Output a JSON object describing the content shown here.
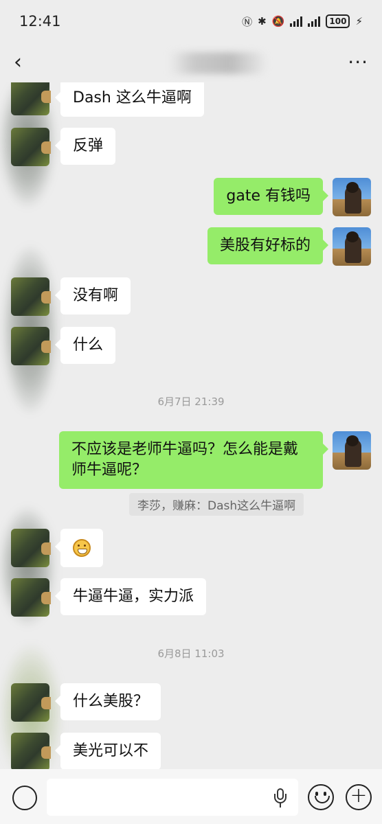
{
  "status_bar": {
    "time": "12:41",
    "battery": "100"
  },
  "nav": {
    "back_icon": "chevron-left-icon",
    "more_icon": "more-dots-icon"
  },
  "messages": [
    {
      "dir": "in",
      "text": "Dash 这么牛逼啊"
    },
    {
      "dir": "in",
      "text": "反弹"
    },
    {
      "dir": "out",
      "text": "gate 有钱吗"
    },
    {
      "dir": "out",
      "text": "美股有好标的"
    },
    {
      "dir": "in",
      "text": "没有啊"
    },
    {
      "dir": "in",
      "text": "什么"
    },
    {
      "dir": "out",
      "text": "不应该是老师牛逼吗？怎么能是戴师牛逼呢？"
    },
    {
      "dir": "in",
      "text": "",
      "emoji": "grinning-face-icon"
    },
    {
      "dir": "in",
      "text": "牛逼牛逼，实力派"
    },
    {
      "dir": "in",
      "text": "什么美股？"
    },
    {
      "dir": "in",
      "text": "美光可以不"
    }
  ],
  "timestamps": [
    "6月7日 21:39",
    "6月8日 11:03"
  ],
  "quote": "李莎，赚麻：Dash这么牛逼啊",
  "input_bar": {
    "voice_icon": "voice-icon",
    "mic_icon": "microphone-icon",
    "emoji_icon": "emoji-icon",
    "plus_icon": "plus-icon"
  }
}
